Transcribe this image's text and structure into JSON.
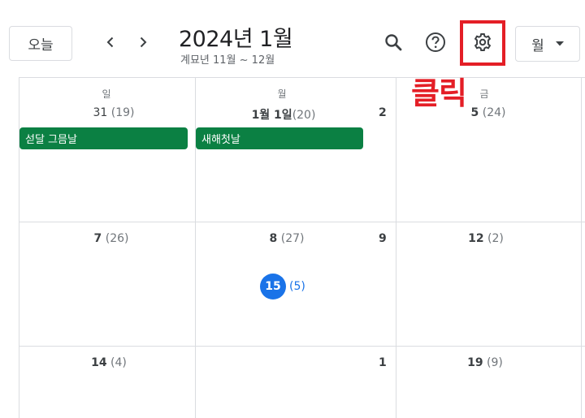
{
  "header": {
    "today_label": "오늘",
    "title": "2024년 1월",
    "subtitle": "계묘년 11월 ~ 12월",
    "view_label": "월",
    "icons": [
      "chevron-left-icon",
      "chevron-right-icon",
      "search-icon",
      "help-icon",
      "gear-icon",
      "arrow-drop-down-icon"
    ]
  },
  "annotation": {
    "label": "클릭",
    "color": "#e41e26"
  },
  "weekdays": {
    "sun": "일",
    "mon": "월",
    "fri": "금"
  },
  "weeks": [
    {
      "sun": {
        "day": "31",
        "lunar": "(19)"
      },
      "mon": {
        "day": "1월 1일",
        "lunar": "(20)"
      },
      "tue_partial": "2",
      "fri": {
        "day": "5",
        "lunar": "(24)"
      }
    },
    {
      "sun": {
        "day": "7",
        "lunar": "(26)"
      },
      "mon": {
        "day": "8",
        "lunar": "(27)"
      },
      "tue_partial": "9",
      "fri": {
        "day": "12",
        "lunar": "(2)"
      }
    },
    {
      "sun": {
        "day": "14",
        "lunar": "(4)"
      },
      "mon": {
        "day": "15",
        "lunar": "(5)"
      },
      "tue_partial": "1",
      "fri": {
        "day": "19",
        "lunar": "(9)"
      }
    }
  ],
  "events": [
    {
      "title": "섣달 그믐날",
      "color": "#0b8043"
    },
    {
      "title": "새해첫날",
      "color": "#0b8043"
    }
  ],
  "colors": {
    "today": "#1a73e8",
    "event": "#0b8043",
    "grid": "#dadce0"
  }
}
